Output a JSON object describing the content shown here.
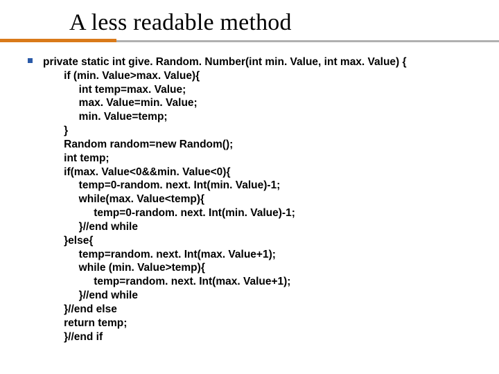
{
  "title": "A less readable method",
  "code": {
    "l00": "private static int give. Random. Number(int min. Value, int max. Value) {",
    "l01": "       if (min. Value>max. Value){",
    "l02": "            int temp=max. Value;",
    "l03": "            max. Value=min. Value;",
    "l04": "            min. Value=temp;",
    "l05": "       }",
    "l06": "       Random random=new Random();",
    "l07": "       int temp;",
    "l08": "       if(max. Value<0&&min. Value<0){",
    "l09": "            temp=0-random. next. Int(min. Value)-1;",
    "l10": "            while(max. Value<temp){",
    "l11": "                 temp=0-random. next. Int(min. Value)-1;",
    "l12": "            }//end while",
    "l13": "       }else{",
    "l14": "            temp=random. next. Int(max. Value+1);",
    "l15": "            while (min. Value>temp){",
    "l16": "                 temp=random. next. Int(max. Value+1);",
    "l17": "            }//end while",
    "l18": "       }//end else",
    "l19": "       return temp;",
    "l20": "       }//end if"
  }
}
